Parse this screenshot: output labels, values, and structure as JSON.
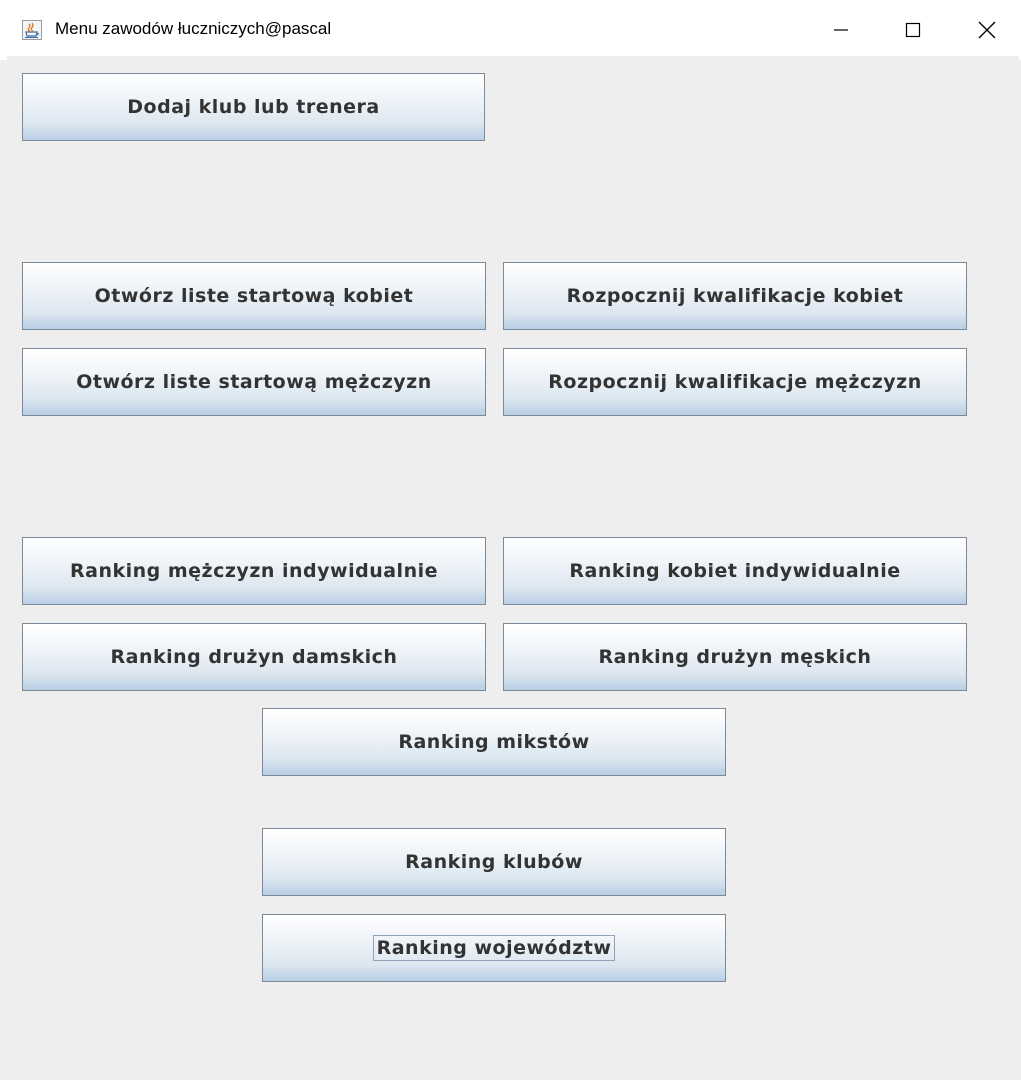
{
  "window": {
    "title": "Menu zawodów łuczniczych@pascal",
    "controls": [
      "minimize",
      "maximize",
      "close"
    ],
    "icon": "java-cup-icon"
  },
  "buttons": {
    "add_club_or_coach": "Dodaj klub lub trenera",
    "open_start_list_women": "Otwórz liste startową kobiet",
    "start_qualification_women": "Rozpocznij kwalifikacje kobiet",
    "open_start_list_men": "Otwórz liste startową mężczyzn",
    "start_qualification_men": "Rozpocznij kwalifikacje mężczyzn",
    "ranking_men_individual": "Ranking mężczyzn indywidualnie",
    "ranking_women_individual": "Ranking kobiet indywidualnie",
    "ranking_women_teams": "Ranking drużyn damskich",
    "ranking_men_teams": "Ranking drużyn męskich",
    "ranking_mixed": "Ranking mikstów",
    "ranking_clubs": "Ranking klubów",
    "ranking_voivodeships": "Ranking województw"
  },
  "colors": {
    "window_bg": "#eeeeee",
    "titlebar_bg": "#ffffff",
    "button_border": "#7a8a99",
    "button_text": "#333333",
    "button_gradient_bottom": "#b8cfe5"
  }
}
